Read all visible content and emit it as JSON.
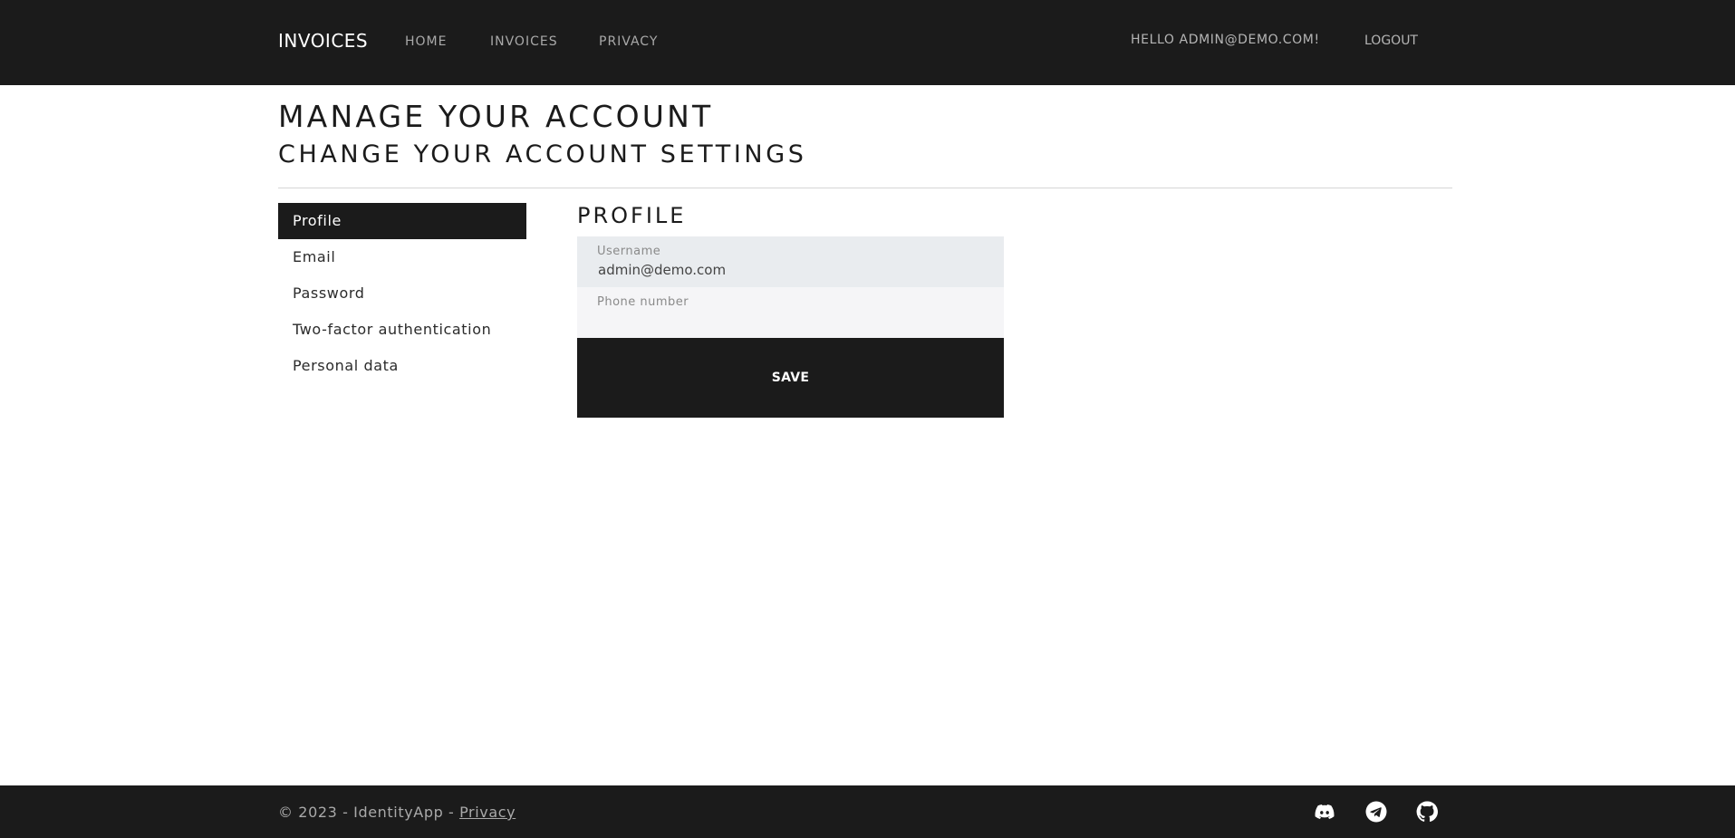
{
  "navbar": {
    "brand": "INVOICES",
    "links": [
      {
        "label": "HOME"
      },
      {
        "label": "INVOICES"
      },
      {
        "label": "PRIVACY"
      }
    ],
    "greeting": "HELLO ADMIN@DEMO.COM!",
    "logout": "LOGOUT"
  },
  "page": {
    "title": "MANAGE YOUR ACCOUNT",
    "subtitle": "CHANGE YOUR ACCOUNT SETTINGS"
  },
  "sidebar": {
    "items": [
      {
        "label": "Profile",
        "active": true
      },
      {
        "label": "Email",
        "active": false
      },
      {
        "label": "Password",
        "active": false
      },
      {
        "label": "Two-factor authentication",
        "active": false
      },
      {
        "label": "Personal data",
        "active": false
      }
    ]
  },
  "profile": {
    "section_title": "PROFILE",
    "username_label": "Username",
    "username_value": "admin@demo.com",
    "phone_label": "Phone number",
    "phone_value": "",
    "save_label": "SAVE"
  },
  "footer": {
    "copyright": "© 2023 - IdentityApp - ",
    "privacy_link": "Privacy",
    "social_icons": [
      "discord-icon",
      "telegram-icon",
      "github-icon"
    ]
  },
  "colors": {
    "dark": "#1b1b1b",
    "nav_text": "#a9a9a9",
    "field_readonly_bg": "#e9ecef",
    "field_bg": "#f5f5f7"
  }
}
